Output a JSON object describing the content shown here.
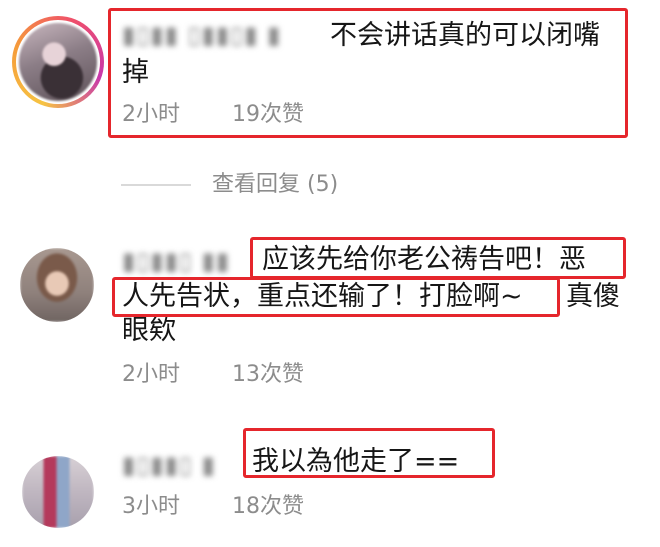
{
  "comments": [
    {
      "text_line1": "不会讲话真的可以闭嘴",
      "text_line2": "掉",
      "time": "2小时",
      "likes": "19次赞"
    },
    {
      "text_line1": "应该先给你老公祷告吧！恶",
      "text_line2a": "人先告状，重点还输了！打脸啊~",
      "text_line2b": "真傻",
      "text_line3": "眼欸",
      "time": "2小时",
      "likes": "13次赞"
    },
    {
      "text_line1": "我以為他走了==",
      "time": "3小时",
      "likes": "18次赞"
    }
  ],
  "view_replies": "查看回复 (5)",
  "colors": {
    "highlight": "#e5262c",
    "meta_text": "#8c8c8c",
    "body_text": "#161616"
  },
  "icons": [
    "story-ring-avatar",
    "avatar"
  ]
}
